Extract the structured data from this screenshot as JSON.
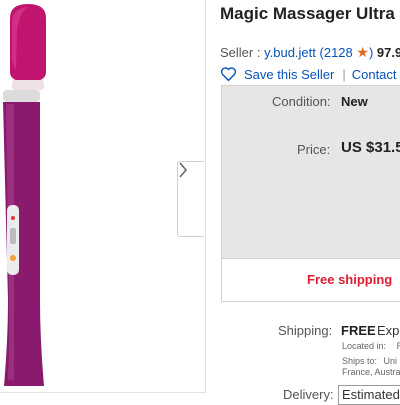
{
  "product": {
    "title": "Magic Massager Ultra P",
    "image_alt": "purple wand massager",
    "colors": {
      "body": "#8a1a6e",
      "head": "#c0146f",
      "accent": "#e4e4e4"
    }
  },
  "seller": {
    "label": "Seller :",
    "name": "y.bud.jett",
    "feedback_count": "(2128",
    "star_icon": "star-icon",
    "feedback_pct": "97.9",
    "save_label": "Save this Seller",
    "contact_label": "Contact se"
  },
  "details": {
    "condition_label": "Condition:",
    "condition_value": "New",
    "price_label": "Price:",
    "price_value": "US $31.5",
    "free_shipping": "Free shipping"
  },
  "shipping": {
    "label": "Shipping:",
    "free": "FREE",
    "method": "Expe",
    "located_label": "Located in:",
    "located_value": "R",
    "ships_to_label": "Ships to:",
    "ships_to_value": "Uni",
    "ships_to_line2": "France, Austra"
  },
  "delivery": {
    "label": "Delivery:",
    "value": "Estimated"
  }
}
